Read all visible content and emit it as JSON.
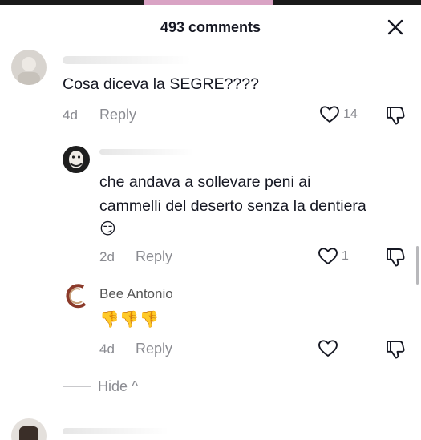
{
  "header": {
    "title": "493 comments"
  },
  "comments": [
    {
      "username": "",
      "text": "Cosa diceva la SEGRE????",
      "age": "4d",
      "reply_label": "Reply",
      "likes": "14"
    },
    {
      "username": "",
      "text_line1": "che andava a sollevare peni ai",
      "text_line2": "cammelli del deserto senza la dentiera",
      "emoji": "😏",
      "age": "2d",
      "reply_label": "Reply",
      "likes": "1"
    },
    {
      "username": "Bee Antonio",
      "emoji": "👎👎👎",
      "age": "4d",
      "reply_label": "Reply",
      "likes": ""
    }
  ],
  "hide_label": "Hide ^",
  "colors": {
    "text": "#161823",
    "muted": "#8a8b91",
    "icon": "#161823"
  },
  "icons": [
    "close-icon",
    "heart-icon",
    "dislike-icon",
    "chevron-up-icon"
  ]
}
